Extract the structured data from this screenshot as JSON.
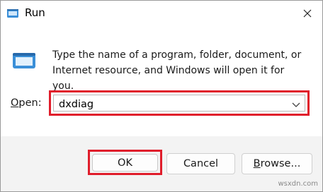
{
  "window": {
    "title": "Run",
    "close_glyph": "✕"
  },
  "body": {
    "description": "Type the name of a program, folder, document, or Internet resource, and Windows will open it for you.",
    "open_label_underlined": "O",
    "open_label_rest": "pen:",
    "open_value": "dxdiag"
  },
  "buttons": {
    "ok": "OK",
    "cancel": "Cancel",
    "browse_underlined": "B",
    "browse_rest": "rowse..."
  },
  "watermark": "wsxdn.com",
  "colors": {
    "highlight": "#e01d2b",
    "footer_bg": "#f3f3f3",
    "icon_blue": "#3a8fd8"
  },
  "icons": {
    "title": "run-app-icon",
    "program": "run-program-icon",
    "close": "close-icon",
    "dropdown": "chevron-down-icon"
  }
}
